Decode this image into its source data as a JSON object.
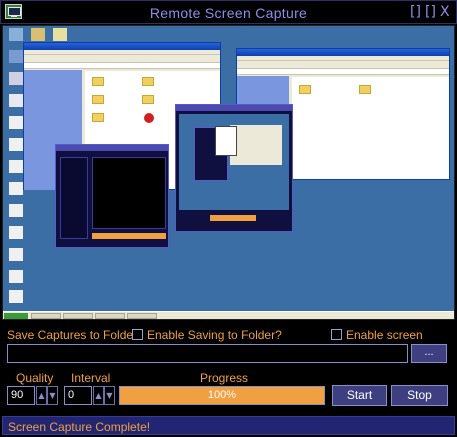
{
  "window": {
    "title": "Remote Screen Capture",
    "buttons": {
      "maximize": "[]",
      "restore": "[]",
      "close": "X"
    }
  },
  "capture": {
    "save_label": "Save Captures to Folder:",
    "enable_saving_label": "Enable Saving to Folder?",
    "enable_saving_checked": false,
    "enable_clicks_label": "Enable screen click(s)",
    "enable_clicks_checked": false,
    "folder_path": "",
    "browse_label": "..."
  },
  "settings": {
    "quality_label": "Quality",
    "quality_value": "90",
    "interval_label": "Interval",
    "interval_value": "0",
    "progress_label": "Progress",
    "progress_text": "100%",
    "progress_value": 1.0,
    "start_label": "Start",
    "stop_label": "Stop"
  },
  "status": {
    "text": "Screen Capture Complete!"
  },
  "colors": {
    "accent": "#f0a040",
    "title": "#8a8ee8",
    "button_bg": "#3d3f80",
    "status_bg": "#222672",
    "desktop": "#3a6ea5"
  },
  "icons": [
    "app-monitor-icon",
    "spin-up-icon",
    "spin-down-icon",
    "dropdown-arrow-icon"
  ]
}
